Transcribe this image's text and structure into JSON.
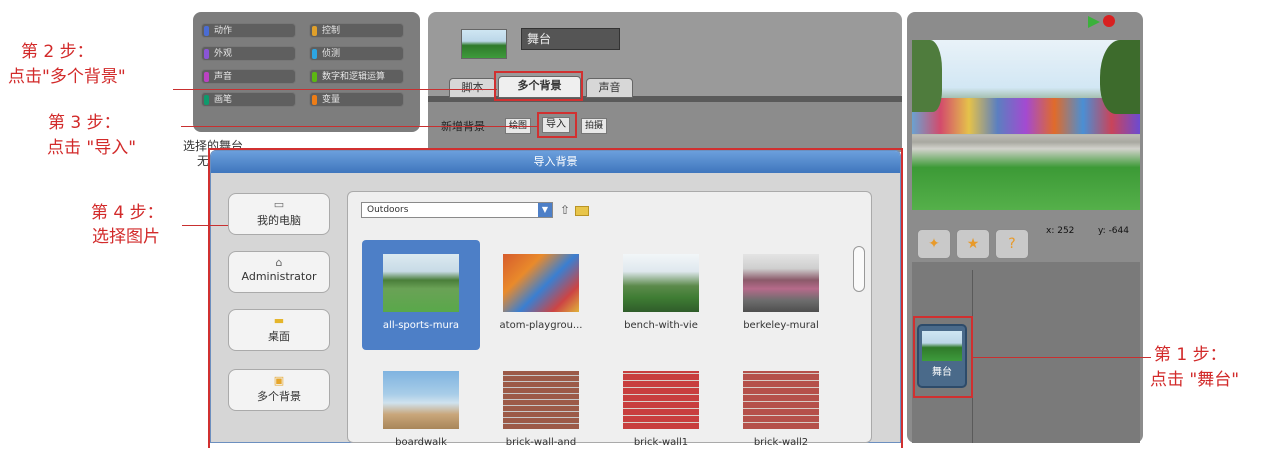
{
  "annotations": {
    "step2_title": "第 2 步：",
    "step2_action": "点击\"多个背景\"",
    "step3_title": "第 3 步：",
    "step3_action": "点击 \"导入\"",
    "step4_title": "第 4 步：",
    "step4_action": "选择图片",
    "step1_title": "第 1 步：",
    "step1_action": "点击 \"舞台\""
  },
  "categories": [
    {
      "label": "动作",
      "color": "#4a6cd4"
    },
    {
      "label": "控制",
      "color": "#e0a02a"
    },
    {
      "label": "外观",
      "color": "#8a55d7"
    },
    {
      "label": "侦测",
      "color": "#2ca5e2"
    },
    {
      "label": "声音",
      "color": "#bb42c3"
    },
    {
      "label": "数字和逻辑运算",
      "color": "#5cb712"
    },
    {
      "label": "画笔",
      "color": "#0e9a6c"
    },
    {
      "label": "变量",
      "color": "#ee7d16"
    }
  ],
  "left_panel": {
    "selected_line": "选择的舞台",
    "selected_line_cut": "无"
  },
  "editor": {
    "stage_name": "舞台",
    "tabs": [
      "脚本",
      "多个背景",
      "声音"
    ],
    "new_background_label": "新增背景",
    "paint_button": "绘图",
    "import_button": "导入",
    "camera_button": "拍摄"
  },
  "dialog": {
    "title": "导入背景",
    "folder": "Outdoors",
    "side_buttons": [
      {
        "label": "我的电脑",
        "icon": "computer-icon"
      },
      {
        "label": "Administrator",
        "icon": "home-icon"
      },
      {
        "label": "桌面",
        "icon": "folder-icon"
      },
      {
        "label": "多个背景",
        "icon": "backgrounds-icon"
      }
    ],
    "files_row1": [
      "all-sports-mura",
      "atom-playgrou...",
      "bench-with-vie",
      "berkeley-mural"
    ],
    "files_row2": [
      "boardwalk",
      "brick-wall-and",
      "brick-wall1",
      "brick-wall2"
    ]
  },
  "stage": {
    "x_readout": "x: 252",
    "y_readout": "y: -644",
    "sprite_label": "舞台"
  },
  "colors": {
    "annotation_red": "#d22a2a",
    "dialog_header": "#4b84c6",
    "panel_gray": "#8a8a8a",
    "selection_blue": "#4d7fc7"
  }
}
